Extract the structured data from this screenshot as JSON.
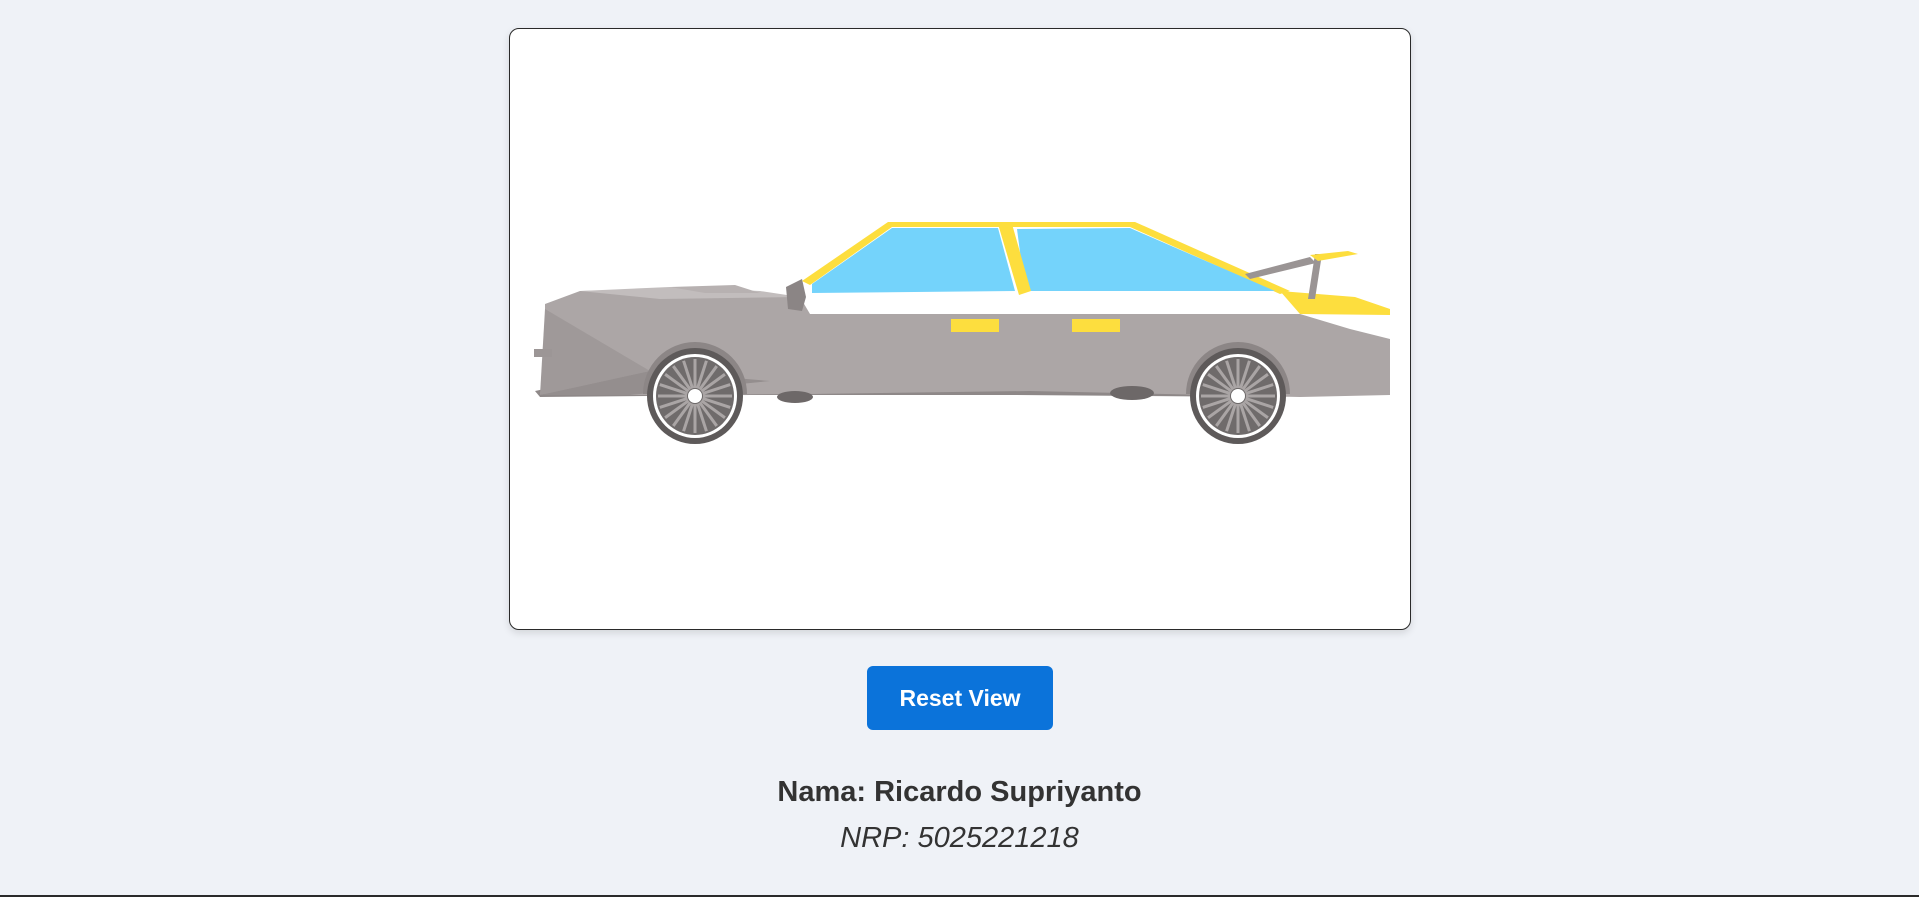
{
  "scene": {
    "model": "low-poly-car",
    "colors": {
      "background": "#ffffff",
      "body": "#aca6a6",
      "body_shadow": "#948e8e",
      "trim": "#fdde3e",
      "glass": "#74d3fb",
      "tire": "#5e5a5a",
      "rim": "#ffffff"
    }
  },
  "controls": {
    "reset_label": "Reset View"
  },
  "author": {
    "name_label": "Nama:",
    "name": "Ricardo Supriyanto",
    "nrp_label": "NRP:",
    "nrp": "5025221218"
  },
  "theme": {
    "page_bg": "#eff2f7",
    "accent": "#0b73da",
    "text": "#333333"
  }
}
